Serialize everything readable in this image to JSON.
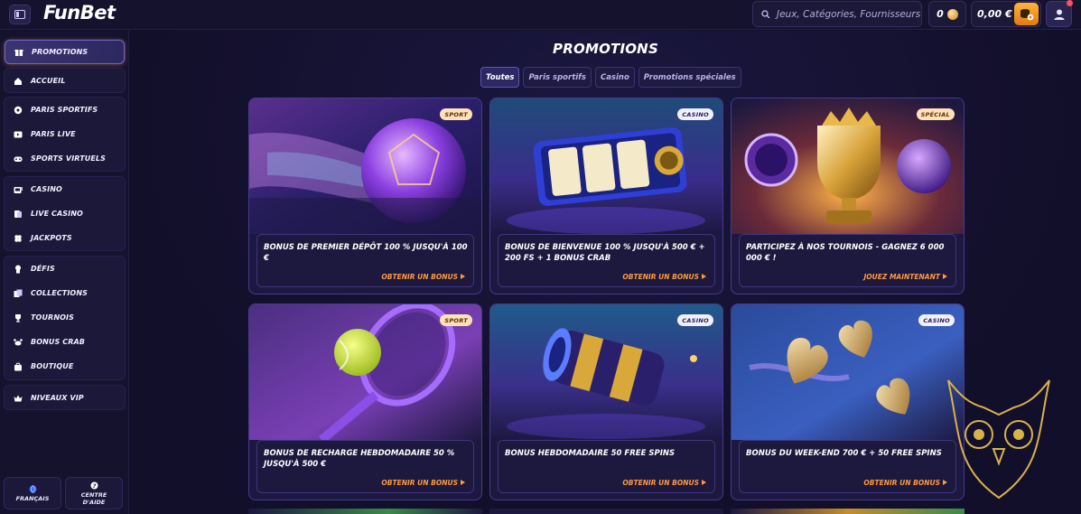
{
  "header": {
    "logo": "FunBet",
    "search_placeholder": "Jeux, Catégories, Fournisseurs",
    "coins": "0",
    "balance": "0,00 €"
  },
  "sidebar": {
    "groups": [
      [
        {
          "label": "PROMOTIONS",
          "icon": "promotions-icon"
        }
      ],
      [
        {
          "label": "ACCUEIL",
          "icon": "home-icon"
        }
      ],
      [
        {
          "label": "PARIS SPORTIFS",
          "icon": "soccer-ball-icon"
        },
        {
          "label": "PARIS LIVE",
          "icon": "live-icon"
        },
        {
          "label": "SPORTS VIRTUELS",
          "icon": "virtual-sports-icon"
        }
      ],
      [
        {
          "label": "CASINO",
          "icon": "slot-machine-icon"
        },
        {
          "label": "LIVE CASINO",
          "icon": "cards-icon"
        },
        {
          "label": "JACKPOTS",
          "icon": "clover-icon"
        }
      ],
      [
        {
          "label": "DÉFIS",
          "icon": "challenge-icon"
        },
        {
          "label": "COLLECTIONS",
          "icon": "collections-icon"
        },
        {
          "label": "TOURNOIS",
          "icon": "trophy-icon"
        },
        {
          "label": "BONUS CRAB",
          "icon": "crab-icon"
        },
        {
          "label": "BOUTIQUE",
          "icon": "shop-icon"
        }
      ],
      [
        {
          "label": "NIVEAUX VIP",
          "icon": "crown-icon"
        }
      ]
    ],
    "language": "FRANÇAIS",
    "help_line1": "CENTRE",
    "help_line2": "D'AIDE"
  },
  "main": {
    "title": "PROMOTIONS",
    "filters": [
      "Toutes",
      "Paris sportifs",
      "Casino",
      "Promotions spéciales"
    ],
    "active_filter": "Toutes",
    "cards": [
      {
        "tag": "SPORT",
        "title": "BONUS DE PREMIER DÉPÔT 100 % JUSQU'À 100 €",
        "cta": "OBTENIR UN BONUS",
        "art": "soccer-ball"
      },
      {
        "tag": "CASINO",
        "title": "BONUS DE BIENVENUE 100 % JUSQU'À 500 € + 200 FS + 1 BONUS CRAB",
        "cta": "OBTENIR UN BONUS",
        "art": "slot-reel"
      },
      {
        "tag": "SPÉCIAL",
        "title": "PARTICIPEZ À NOS TOURNOIS - GAGNEZ 6 000 000 € !",
        "cta": "JOUEZ MAINTENANT",
        "art": "trophy"
      },
      {
        "tag": "SPORT",
        "title": "BONUS DE RECHARGE HEBDOMADAIRE 50 % JUSQU'À 500 €",
        "cta": "OBTENIR UN BONUS",
        "art": "tennis"
      },
      {
        "tag": "CASINO",
        "title": "BONUS HEBDOMADAIRE 50 FREE SPINS",
        "cta": "OBTENIR UN BONUS",
        "art": "barrel"
      },
      {
        "tag": "CASINO",
        "title": "BONUS DU WEEK-END 700 € + 50 FREE SPINS",
        "cta": "OBTENIR UN BONUS",
        "art": "hearts"
      }
    ]
  },
  "colors": {
    "accent": "#ff9a3d",
    "background": "#120f2a",
    "card_border": "#453d8c"
  }
}
